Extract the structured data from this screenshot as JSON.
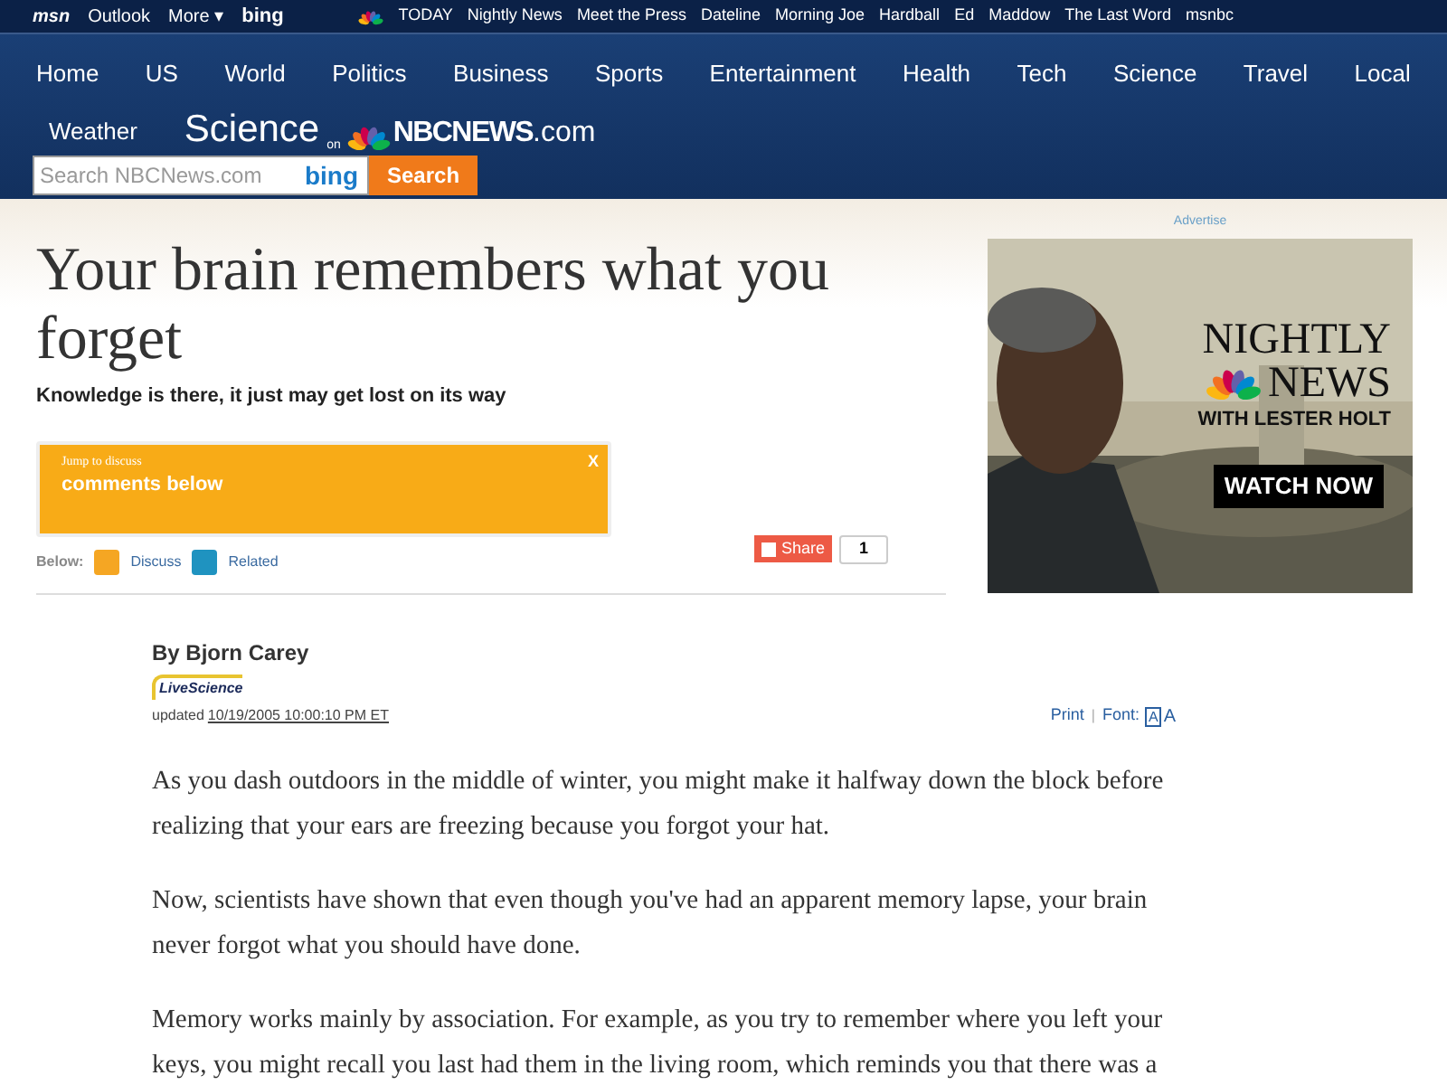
{
  "top_bar": {
    "left": [
      "Outlook",
      "More",
      "bing"
    ],
    "caret": "▾",
    "right": [
      "TODAY",
      "Nightly News",
      "Meet the Press",
      "Dateline",
      "Morning Joe",
      "Hardball",
      "Ed",
      "Maddow",
      "The Last Word",
      "msnbc"
    ],
    "logo": "msn"
  },
  "nav": [
    "Home",
    "US",
    "World",
    "Politics",
    "Business",
    "Sports",
    "Entertainment",
    "Health",
    "Tech",
    "Science",
    "Travel",
    "Local",
    "Weather"
  ],
  "section": {
    "title": "Science",
    "on": "on",
    "brand": "NBCNEWS",
    "brand_suffix": ".com"
  },
  "search": {
    "placeholder": "Search NBCNews.com",
    "engine": "bing",
    "button": "Search"
  },
  "article": {
    "title": "Your brain remembers what you forget",
    "subtitle": "Knowledge is there, it just may get lost on its way",
    "callout": {
      "small": "Jump to discuss",
      "big": "comments below",
      "close": "X"
    },
    "below_label": "Below:",
    "below_links": [
      {
        "label": "Discuss",
        "color": "#f5a623"
      },
      {
        "label": "Related",
        "color": "#1f93c0"
      }
    ],
    "share": "Share",
    "share_count": "1",
    "byline": "By Bjorn Carey",
    "source_logo": "LiveScience",
    "updated": "updated",
    "date": "10/19/2005 10:00:10 PM ET",
    "print": "Print",
    "separator": "|",
    "font_label": "Font:",
    "font_icon": "A",
    "font_big": "A",
    "paragraphs": [
      "As you dash outdoors in the middle of winter, you might make it halfway down the block before realizing that your ears are freezing because you forgot your hat.",
      "Now, scientists have shown that even though you've had an apparent memory lapse, your brain never forgot what you should have done.",
      "Memory works mainly by association. For example, as you try to remember where you left your keys, you might recall you last had them in the living room, which reminds you that there was a"
    ]
  },
  "ad": {
    "label": "Advertise",
    "line1": "NIGHTLY",
    "line2": "NEWS",
    "line3": "WITH LESTER HOLT",
    "button": "WATCH NOW"
  }
}
